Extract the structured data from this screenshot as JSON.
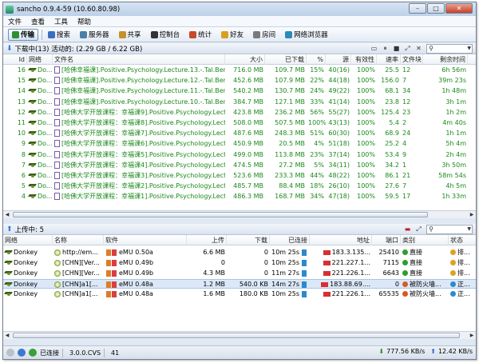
{
  "window": {
    "title": "sancho 0.9.4-59 (10.60.80.98)",
    "buttons": [
      "–",
      "□",
      "✕"
    ]
  },
  "menubar": [
    "文件",
    "查看",
    "工具",
    "帮助"
  ],
  "toolbar": [
    {
      "label": "传输",
      "icon": "transfer-icon",
      "color": "#2f8f2f",
      "active": true
    },
    {
      "label": "搜索",
      "icon": "search-icon",
      "color": "#3a6fc0"
    },
    {
      "label": "服务器",
      "icon": "server-icon",
      "color": "#4a7fa8"
    },
    {
      "label": "共享",
      "icon": "share-icon",
      "color": "#c8902a"
    },
    {
      "label": "控制台",
      "icon": "console-icon",
      "color": "#333333"
    },
    {
      "label": "统计",
      "icon": "stats-icon",
      "color": "#c84a2a"
    },
    {
      "label": "好友",
      "icon": "friends-icon",
      "color": "#d8a020"
    },
    {
      "label": "房间",
      "icon": "room-icon",
      "color": "#7a7a7a"
    },
    {
      "label": "网络浏览器",
      "icon": "browser-icon",
      "color": "#2a8ab8"
    }
  ],
  "downloads": {
    "summary": "下载中(13) 活动的: (2.29 GB / 6.22 GB)",
    "columns": [
      "Id",
      "网络",
      "文件名",
      "大小",
      "已下载",
      "%",
      "源",
      "有效性",
      "速率",
      "文件块",
      "剩余时间"
    ],
    "rows": [
      {
        "id": "16",
        "net": "Do...",
        "file": "[哈佛幸福课].Positive.Psychology.Lecture.13.-.Tal.Ben-...",
        "size": "716.0 MB",
        "done": "109.7 MB",
        "pct": "15%",
        "src": "40(16)",
        "avail": "100%",
        "rate": "25.5",
        "chunks": "12",
        "eta": "6h 56m"
      },
      {
        "id": "15",
        "net": "Do...",
        "file": "[哈佛幸福课].Positive.Psychology.Lecture.12.-.Tal.Ben-...",
        "size": "452.6 MB",
        "done": "107.9 MB",
        "pct": "22%",
        "src": "44(18)",
        "avail": "100%",
        "rate": "156.0",
        "chunks": "7",
        "eta": "39m 23s"
      },
      {
        "id": "14",
        "net": "Do...",
        "file": "[哈佛幸福课].Positive.Psychology.Lecture.11.-.Tal.Ben-...",
        "size": "540.2 MB",
        "done": "130.7 MB",
        "pct": "24%",
        "src": "49(22)",
        "avail": "100%",
        "rate": "68.1",
        "chunks": "34",
        "eta": "1h 48m"
      },
      {
        "id": "13",
        "net": "Do...",
        "file": "[哈佛幸福课].Positive.Psychology.Lecture.10.-.Tal.Ben-...",
        "size": "384.7 MB",
        "done": "127.1 MB",
        "pct": "33%",
        "src": "41(14)",
        "avail": "100%",
        "rate": "23.8",
        "chunks": "12",
        "eta": "3h 1m"
      },
      {
        "id": "12",
        "net": "Do...",
        "file": "[哈佛大学开放课程：幸福课9].Positive.Psychology.Lectu...",
        "size": "423.8 MB",
        "done": "236.2 MB",
        "pct": "56%",
        "src": "55(27)",
        "avail": "100%",
        "rate": "125.4",
        "chunks": "23",
        "eta": "1h 2m"
      },
      {
        "id": "11",
        "net": "Do...",
        "file": "[哈佛大学开放课程：幸福课8].Positive.Psychology.Lectu...",
        "size": "508.0 MB",
        "done": "507.5 MB",
        "pct": "100%",
        "src": "43(13)",
        "avail": "100%",
        "rate": "5.4",
        "chunks": "2",
        "eta": "4m 40s"
      },
      {
        "id": "10",
        "net": "Do...",
        "file": "[哈佛大学开放课程：幸福课7].Positive.Psychology.Lectu...",
        "size": "487.6 MB",
        "done": "248.3 MB",
        "pct": "51%",
        "src": "60(30)",
        "avail": "100%",
        "rate": "68.9",
        "chunks": "24",
        "eta": "1h 1m"
      },
      {
        "id": "9",
        "net": "Do...",
        "file": "[哈佛大学开放课程：幸福课6].Positive.Psychology.Lectu...",
        "size": "450.9 MB",
        "done": "20.5 MB",
        "pct": "4%",
        "src": "51(18)",
        "avail": "100%",
        "rate": "25.2",
        "chunks": "4",
        "eta": "5h 4m"
      },
      {
        "id": "8",
        "net": "Do...",
        "file": "[哈佛大学开放课程：幸福课5].Positive.Psychology.Lectu...",
        "size": "499.0 MB",
        "done": "113.8 MB",
        "pct": "23%",
        "src": "37(14)",
        "avail": "100%",
        "rate": "53.4",
        "chunks": "9",
        "eta": "2h 4m"
      },
      {
        "id": "7",
        "net": "Do...",
        "file": "[哈佛大学开放课程：幸福课4].Positive.Psychology.Lectu...",
        "size": "474.5 MB",
        "done": "27.2 MB",
        "pct": "5%",
        "src": "34(11)",
        "avail": "100%",
        "rate": "34.2",
        "chunks": "1",
        "eta": "3h 50m"
      },
      {
        "id": "6",
        "net": "Do...",
        "file": "[哈佛大学开放课程：幸福课3].Positive.Psychology.Lectu...",
        "size": "523.6 MB",
        "done": "233.3 MB",
        "pct": "44%",
        "src": "48(22)",
        "avail": "100%",
        "rate": "86.1",
        "chunks": "21",
        "eta": "58m 54s"
      },
      {
        "id": "5",
        "net": "Do...",
        "file": "[哈佛大学开放课程：幸福课2].Positive.Psychology.Lectu...",
        "size": "485.7 MB",
        "done": "88.4 MB",
        "pct": "18%",
        "src": "26(10)",
        "avail": "100%",
        "rate": "27.6",
        "chunks": "7",
        "eta": "4h 5m"
      },
      {
        "id": "4",
        "net": "Do...",
        "file": "[哈佛大学开放课程：幸福课1].Positive.Psychology.Lectu...",
        "size": "486.3 MB",
        "done": "168.7 MB",
        "pct": "34%",
        "src": "47(18)",
        "avail": "100%",
        "rate": "59.5",
        "chunks": "17",
        "eta": "1h 33m"
      }
    ]
  },
  "uploads": {
    "summary": "上传中: 5",
    "columns": [
      "网络",
      "名称",
      "软件",
      "上传",
      "下载",
      "已连接",
      "地址",
      "端口",
      "类别",
      "状态"
    ],
    "rows": [
      {
        "net": "Donkey",
        "name": "http://em...",
        "soft": "eMU 0.50a",
        "up": "6.6 MB",
        "down": "0",
        "conn": "10m 25s",
        "addr": "183.3.135...",
        "port": "25410",
        "cat": "直接",
        "state": "排..."
      },
      {
        "net": "Donkey",
        "name": "[CHN][Ver...",
        "soft": "eMU 0.49b",
        "up": "0",
        "down": "0",
        "conn": "10m 25s",
        "addr": "221.227.1...",
        "port": "7115",
        "cat": "直接",
        "state": "排..."
      },
      {
        "net": "Donkey",
        "name": "[CHN][Ver...",
        "soft": "eMU 0.49b",
        "up": "4.3 MB",
        "down": "0",
        "conn": "11m 27s",
        "addr": "221.226.1...",
        "port": "6643",
        "cat": "直接",
        "state": "排..."
      },
      {
        "net": "Donkey",
        "name": "[CHN]a1[...",
        "soft": "eMU 0.48a",
        "up": "1.2 MB",
        "down": "540.0 KB",
        "conn": "14m 27s",
        "addr": "183.88.69....",
        "port": "0",
        "cat": "被防火墙...",
        "state": "正...",
        "selected": true
      },
      {
        "net": "Donkey",
        "name": "[CHN]a1[...",
        "soft": "eMU 0.48a",
        "up": "1.6 MB",
        "down": "180.0 KB",
        "conn": "10m 25s",
        "addr": "221.226.1...",
        "port": "65535",
        "cat": "被防火墙...",
        "state": "正..."
      }
    ]
  },
  "statusbar": {
    "connection": "已连接",
    "version": "3.0.0.CVS",
    "count": "41",
    "down_rate": "777.56 KB/s",
    "up_rate": "12.42 KB/s"
  }
}
